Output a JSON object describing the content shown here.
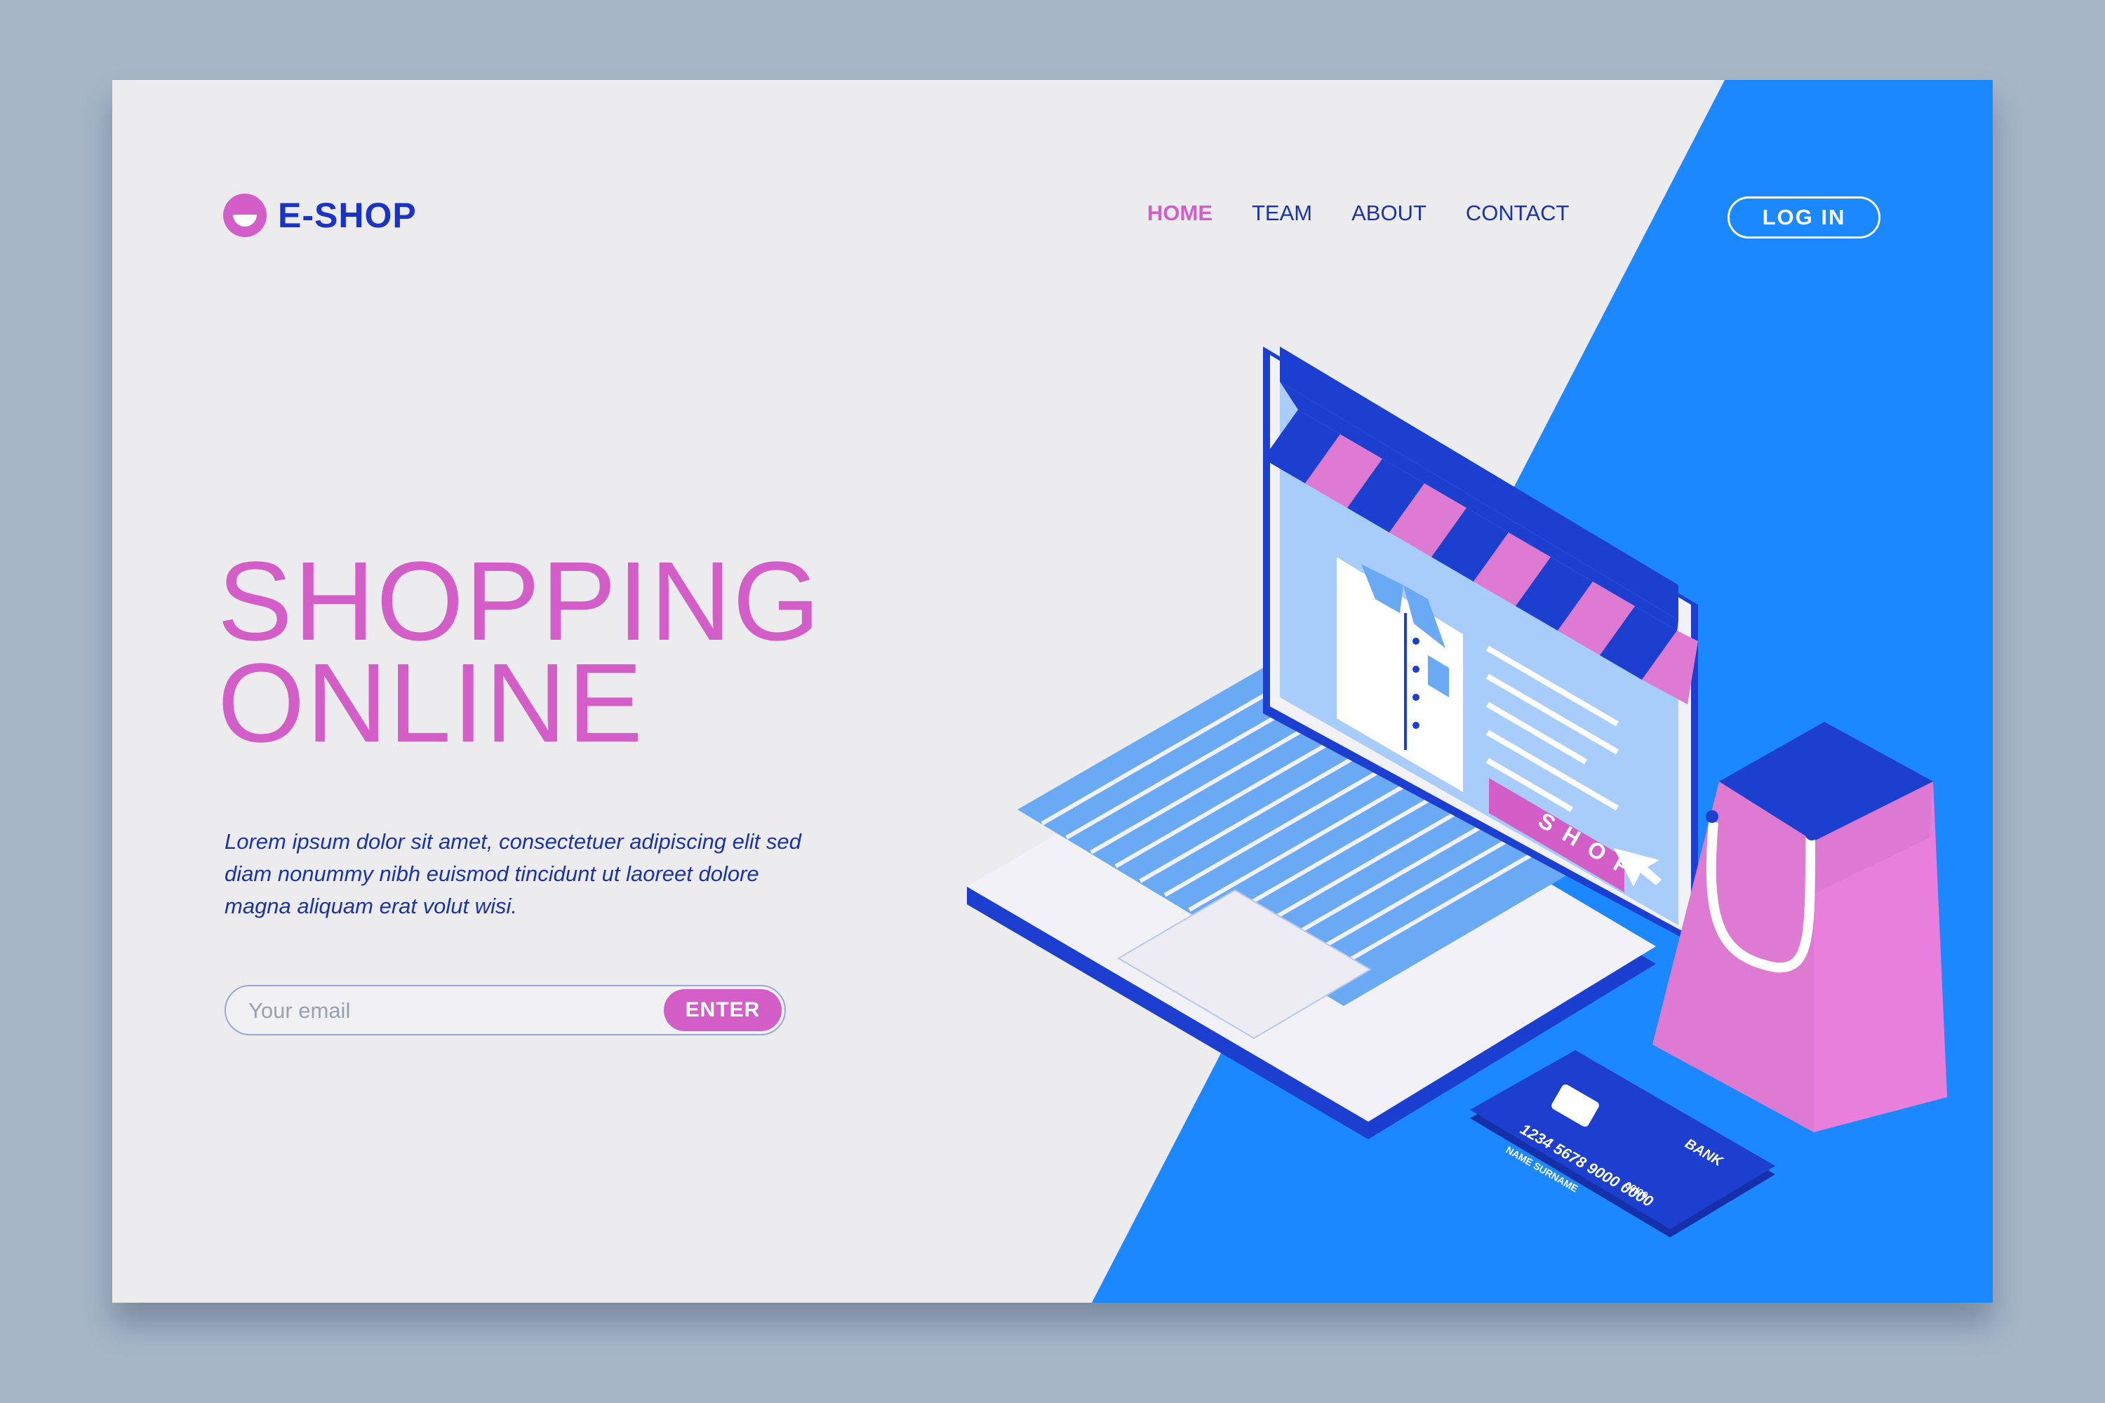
{
  "brand": {
    "name": "E-SHOP",
    "accent": "#d35ec8",
    "primary": "#1a33c7",
    "blue_bg": "#1b88ff"
  },
  "nav": {
    "items": [
      {
        "label": "HOME",
        "active": true
      },
      {
        "label": "TEAM",
        "active": false
      },
      {
        "label": "ABOUT",
        "active": false
      },
      {
        "label": "CONTACT",
        "active": false
      }
    ],
    "login_label": "LOG IN"
  },
  "hero": {
    "title_line1": "SHOPPING",
    "title_line2": "ONLINE",
    "text": "Lorem ipsum dolor sit amet, consectetuer adipiscing elit sed diam nonummy nibh euismod tincidunt ut laoreet dolore magna aliquam erat volut wisi."
  },
  "subscribe": {
    "placeholder": "Your email",
    "button_label": "ENTER"
  },
  "illustration": {
    "shop_button": "SHOP",
    "card_number": "1234 5678 9000 0000",
    "card_name": "NAME SURNAME",
    "card_bank": "BANK",
    "card_valid": "00/00"
  }
}
